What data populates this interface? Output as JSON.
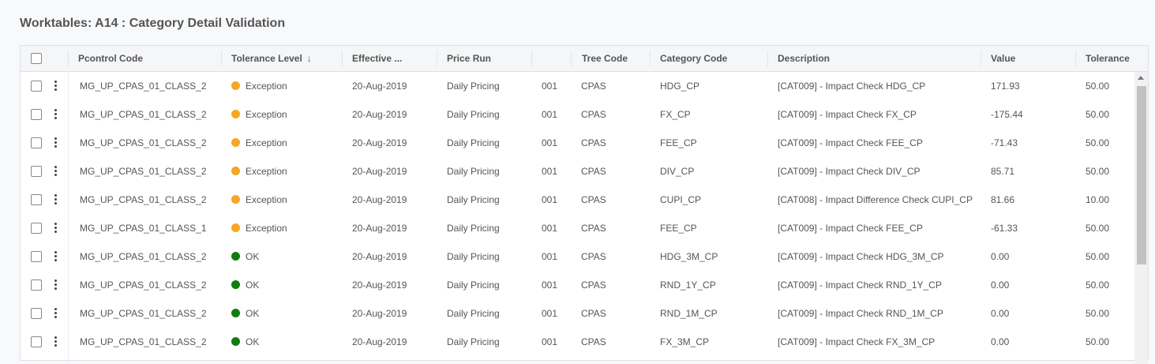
{
  "page": {
    "title": "Worktables: A14 : Category Detail Validation"
  },
  "columns": {
    "pcontrol": "Pcontrol Code",
    "tolerance_level": "Tolerance Level",
    "sort_indicator": "↓",
    "effective": "Effective ...",
    "price_run": "Price Run",
    "run_no": "",
    "tree_code": "Tree Code",
    "category_code": "Category Code",
    "description": "Description",
    "value": "Value",
    "tolerance": "Tolerance"
  },
  "status_colors": {
    "Exception": "#f5a623",
    "OK": "#107c10"
  },
  "rows": [
    {
      "pcontrol": "MG_UP_CPAS_01_CLASS_2",
      "level": "Exception",
      "effective": "20-Aug-2019",
      "price_run": "Daily Pricing",
      "run_no": "001",
      "tree": "CPAS",
      "category": "HDG_CP",
      "description": "[CAT009] - Impact Check HDG_CP",
      "value": "171.93",
      "tolerance": "50.00"
    },
    {
      "pcontrol": "MG_UP_CPAS_01_CLASS_2",
      "level": "Exception",
      "effective": "20-Aug-2019",
      "price_run": "Daily Pricing",
      "run_no": "001",
      "tree": "CPAS",
      "category": "FX_CP",
      "description": "[CAT009] - Impact Check FX_CP",
      "value": "-175.44",
      "tolerance": "50.00"
    },
    {
      "pcontrol": "MG_UP_CPAS_01_CLASS_2",
      "level": "Exception",
      "effective": "20-Aug-2019",
      "price_run": "Daily Pricing",
      "run_no": "001",
      "tree": "CPAS",
      "category": "FEE_CP",
      "description": "[CAT009] - Impact Check FEE_CP",
      "value": "-71.43",
      "tolerance": "50.00"
    },
    {
      "pcontrol": "MG_UP_CPAS_01_CLASS_2",
      "level": "Exception",
      "effective": "20-Aug-2019",
      "price_run": "Daily Pricing",
      "run_no": "001",
      "tree": "CPAS",
      "category": "DIV_CP",
      "description": "[CAT009] - Impact Check DIV_CP",
      "value": "85.71",
      "tolerance": "50.00"
    },
    {
      "pcontrol": "MG_UP_CPAS_01_CLASS_2",
      "level": "Exception",
      "effective": "20-Aug-2019",
      "price_run": "Daily Pricing",
      "run_no": "001",
      "tree": "CPAS",
      "category": "CUPI_CP",
      "description": "[CAT008] - Impact Difference Check CUPI_CP",
      "value": "81.66",
      "tolerance": "10.00"
    },
    {
      "pcontrol": "MG_UP_CPAS_01_CLASS_1",
      "level": "Exception",
      "effective": "20-Aug-2019",
      "price_run": "Daily Pricing",
      "run_no": "001",
      "tree": "CPAS",
      "category": "FEE_CP",
      "description": "[CAT009] - Impact Check FEE_CP",
      "value": "-61.33",
      "tolerance": "50.00"
    },
    {
      "pcontrol": "MG_UP_CPAS_01_CLASS_2",
      "level": "OK",
      "effective": "20-Aug-2019",
      "price_run": "Daily Pricing",
      "run_no": "001",
      "tree": "CPAS",
      "category": "HDG_3M_CP",
      "description": "[CAT009] - Impact Check HDG_3M_CP",
      "value": "0.00",
      "tolerance": "50.00"
    },
    {
      "pcontrol": "MG_UP_CPAS_01_CLASS_2",
      "level": "OK",
      "effective": "20-Aug-2019",
      "price_run": "Daily Pricing",
      "run_no": "001",
      "tree": "CPAS",
      "category": "RND_1Y_CP",
      "description": "[CAT009] - Impact Check RND_1Y_CP",
      "value": "0.00",
      "tolerance": "50.00"
    },
    {
      "pcontrol": "MG_UP_CPAS_01_CLASS_2",
      "level": "OK",
      "effective": "20-Aug-2019",
      "price_run": "Daily Pricing",
      "run_no": "001",
      "tree": "CPAS",
      "category": "RND_1M_CP",
      "description": "[CAT009] - Impact Check RND_1M_CP",
      "value": "0.00",
      "tolerance": "50.00"
    },
    {
      "pcontrol": "MG_UP_CPAS_01_CLASS_2",
      "level": "OK",
      "effective": "20-Aug-2019",
      "price_run": "Daily Pricing",
      "run_no": "001",
      "tree": "CPAS",
      "category": "FX_3M_CP",
      "description": "[CAT009] - Impact Check FX_3M_CP",
      "value": "0.00",
      "tolerance": "50.00"
    }
  ]
}
